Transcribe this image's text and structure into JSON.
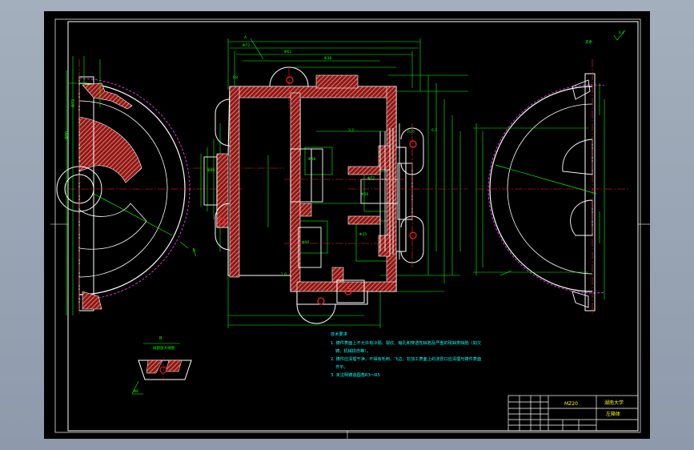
{
  "drawing": {
    "colors": {
      "background": "#000000",
      "frame": "#ffffff",
      "outline": "#ffffff",
      "dimension": "#00ff00",
      "centerline": "#ff2020",
      "section_fill": "#ff8c80",
      "hidden": "#ff40ff",
      "hole": "#ff2020",
      "note_text": "#00ffff",
      "accent_text": "#ffff00"
    },
    "icons": [
      "roughness-symbol-icon",
      "hole-marker-icon"
    ],
    "title_block": {
      "drawing_number": "MZ20",
      "school": "湖南大学",
      "part_name": "左箱体"
    },
    "detail": {
      "label": "B",
      "subtitle": "局部放大视图"
    },
    "top_right_note": "其余",
    "tech_requirements": [
      "技术要求",
      "1. 铸件表面上不允许有冷隔、裂纹、缩孔和穿透性缺陷及严重的残缺类缺陷（如欠",
      "铸、机械损伤等）。",
      "2. 铸件应清理干净，不得有毛刺、飞边，非加工表面上的浇冒口应清理与铸件表面",
      "齐平。",
      "3. 未注明铸造圆角R3～R5"
    ],
    "dimension_labels": [
      "Φ48",
      "Φ40",
      "Φ56",
      "Φ52",
      "Φ35",
      "Φ38",
      "Φ62",
      "Φ72",
      "Φ80",
      "R8",
      "R10",
      "6.3",
      "3.2",
      "1.6",
      "A",
      "B"
    ]
  }
}
